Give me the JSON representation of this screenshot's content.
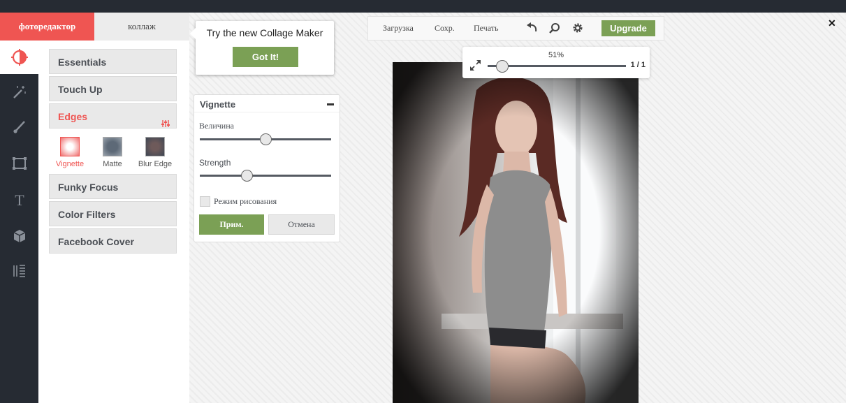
{
  "tabs": {
    "photo_editor": "фоторедактор",
    "collage": "коллаж"
  },
  "rail": {
    "items": [
      {
        "icon": "contrast-icon",
        "active": true
      },
      {
        "icon": "magic-wand-icon"
      },
      {
        "icon": "brush-icon"
      },
      {
        "icon": "frame-icon"
      },
      {
        "icon": "text-icon"
      },
      {
        "icon": "cube-icon"
      },
      {
        "icon": "texture-icon"
      }
    ]
  },
  "menu": {
    "items": [
      {
        "label": "Essentials"
      },
      {
        "label": "Touch Up"
      },
      {
        "label": "Edges",
        "active": true
      },
      {
        "label": "Funky Focus"
      },
      {
        "label": "Color Filters"
      },
      {
        "label": "Facebook Cover"
      }
    ],
    "effects": [
      {
        "label": "Vignette",
        "active": true
      },
      {
        "label": "Matte"
      },
      {
        "label": "Blur Edge"
      }
    ]
  },
  "tooltip": {
    "title": "Try the new Collage Maker",
    "button": "Got It!"
  },
  "vignette_panel": {
    "title": "Vignette",
    "slider1_label": "Величина",
    "slider1_value": 0.5,
    "slider2_label": "Strength",
    "slider2_value": 0.36,
    "draw_mode_label": "Режим рисования",
    "draw_mode_checked": false,
    "apply_label": "Прим.",
    "cancel_label": "Отмена"
  },
  "toolbar": {
    "load_label": "Загрузка",
    "save_label": "Сохр.",
    "print_label": "Печать",
    "upgrade_label": "Upgrade"
  },
  "zoom": {
    "percent": "51%",
    "level": 0.06,
    "page": "1 / 1"
  },
  "colors": {
    "accent_red": "#ef5552",
    "accent_green": "#7ba055",
    "dark": "#262b33"
  }
}
